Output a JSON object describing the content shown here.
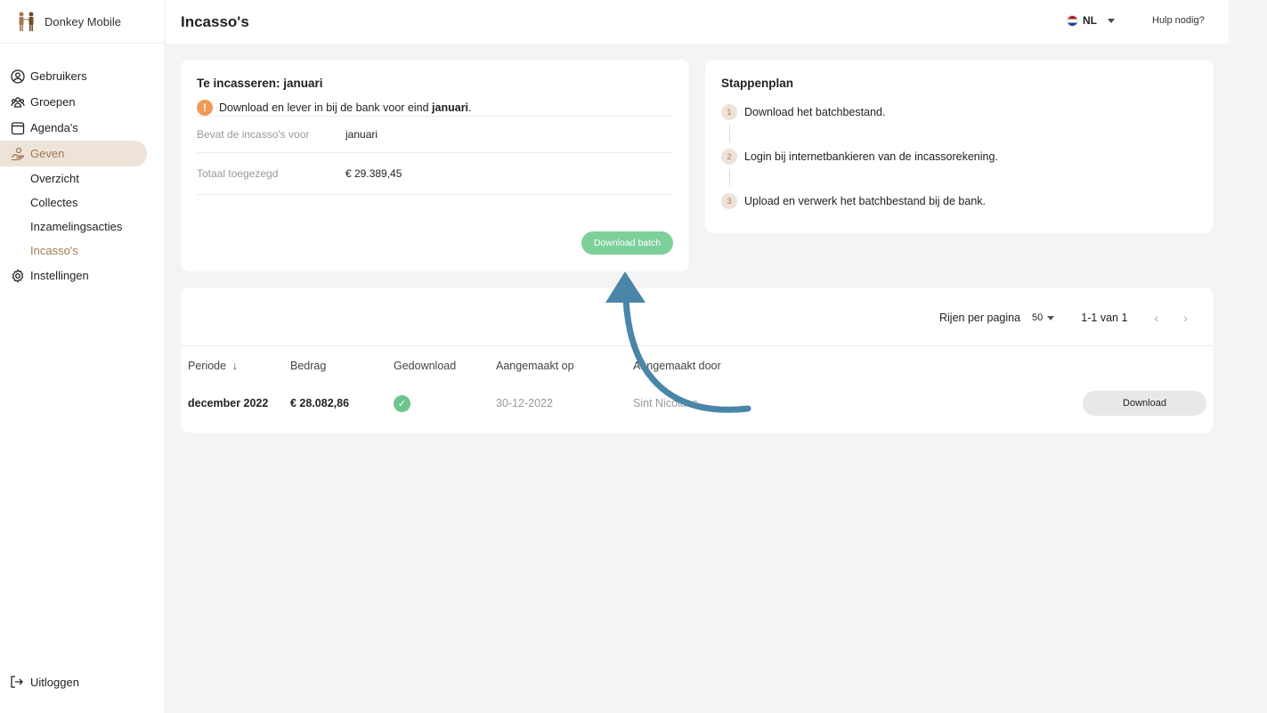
{
  "brand": {
    "name": "Donkey Mobile",
    "logo_icon": "people-icon"
  },
  "sidebar": {
    "items": [
      {
        "label": "Gebruikers",
        "icon": "user-circle-icon"
      },
      {
        "label": "Groepen",
        "icon": "group-icon"
      },
      {
        "label": "Agenda's",
        "icon": "calendar-icon"
      },
      {
        "label": "Geven",
        "icon": "giving-hand-icon"
      },
      {
        "label": "Instellingen",
        "icon": "gear-icon"
      }
    ],
    "sub_items": [
      {
        "label": "Overzicht"
      },
      {
        "label": "Collectes"
      },
      {
        "label": "Inzamelingsacties"
      },
      {
        "label": "Incasso's"
      }
    ],
    "logout": "Uitloggen"
  },
  "header": {
    "title": "Incasso's",
    "language": "NL",
    "help": "Hulp nodig?"
  },
  "collect_card": {
    "title": "Te incasseren: januari",
    "warning_prefix": "Download en lever in bij de bank voor eind ",
    "warning_bold": "januari",
    "warning_suffix": ".",
    "rows": [
      {
        "key": "Bevat de incasso's voor",
        "value": "januari"
      },
      {
        "key": "Totaal toegezegd",
        "value": "€ 29.389,45"
      }
    ],
    "button": "Download batch"
  },
  "steps_card": {
    "title": "Stappenplan",
    "steps": [
      {
        "num": "1",
        "text": "Download het batchbestand."
      },
      {
        "num": "2",
        "text": "Login bij internetbankieren van de incassorekening."
      },
      {
        "num": "3",
        "text": "Upload en verwerk het batchbestand bij de bank."
      }
    ]
  },
  "table": {
    "rows_per_page_label": "Rijen per pagina",
    "rows_per_page": "50",
    "range": "1-1 van 1",
    "columns": [
      "Periode",
      "Bedrag",
      "Gedownload",
      "Aangemaakt op",
      "Aangemaakt door"
    ],
    "rows": [
      {
        "periode": "december 2022",
        "bedrag": "€ 28.082,86",
        "gedownload": true,
        "aangemaakt_op": "30-12-2022",
        "aangemaakt_door": "Sint Nicolaas",
        "action": "Download"
      }
    ]
  },
  "colors": {
    "accent": "#a37a52",
    "accent_bg": "#ede3d8",
    "success": "#7ed09a",
    "warning": "#ee9a54",
    "annotation_arrow": "#4a86a8"
  }
}
